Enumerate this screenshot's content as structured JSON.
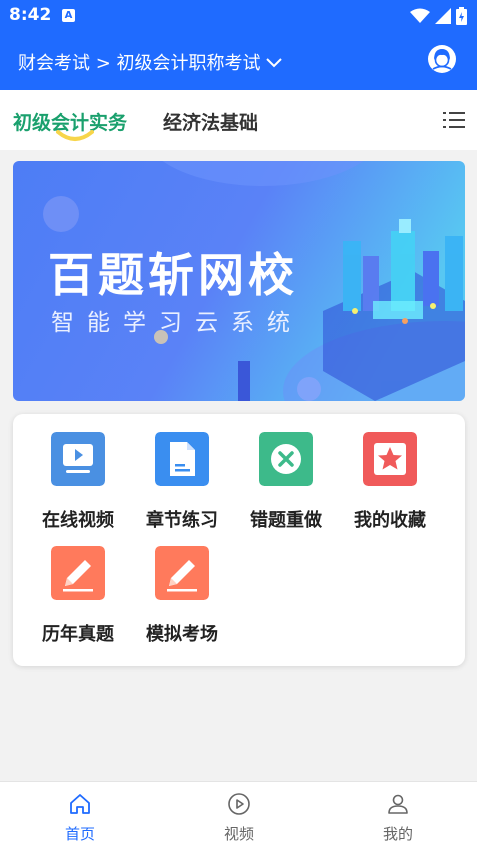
{
  "status_bar": {
    "time": "8:42",
    "notification_badge": "A"
  },
  "header": {
    "breadcrumb": "财会考试 > 初级会计职称考试",
    "dropdown_icon": "chevron-down-icon",
    "avatar_icon": "user-avatar-icon"
  },
  "subject_tabs": {
    "items": [
      {
        "label": "初级会计实务",
        "active": true
      },
      {
        "label": "经济法基础",
        "active": false
      }
    ],
    "active_color": "#1aa06d",
    "menu_icon": "list-icon"
  },
  "banner": {
    "title": "百题斩网校",
    "subtitle": "智能学习云系统"
  },
  "features": [
    {
      "label": "在线视频",
      "icon": "video-player-icon",
      "color": "#4a90e2"
    },
    {
      "label": "章节练习",
      "icon": "document-icon",
      "color": "#3a8ef0"
    },
    {
      "label": "错题重做",
      "icon": "cross-mark-icon",
      "color": "#3dba8a"
    },
    {
      "label": "我的收藏",
      "icon": "star-icon",
      "color": "#f05a5a"
    },
    {
      "label": "历年真题",
      "icon": "pencil-icon",
      "color": "#ff7a5c"
    },
    {
      "label": "模拟考场",
      "icon": "pencil-icon",
      "color": "#ff7a5c"
    }
  ],
  "bottom_nav": {
    "items": [
      {
        "label": "首页",
        "icon": "home-icon",
        "active": true
      },
      {
        "label": "视频",
        "icon": "play-circle-icon",
        "active": false
      },
      {
        "label": "我的",
        "icon": "person-icon",
        "active": false
      }
    ],
    "active_color": "#1f6bff",
    "inactive_color": "#666666"
  },
  "colors": {
    "header_bg": "#1f6bff",
    "page_bg": "#f2f2f2"
  }
}
